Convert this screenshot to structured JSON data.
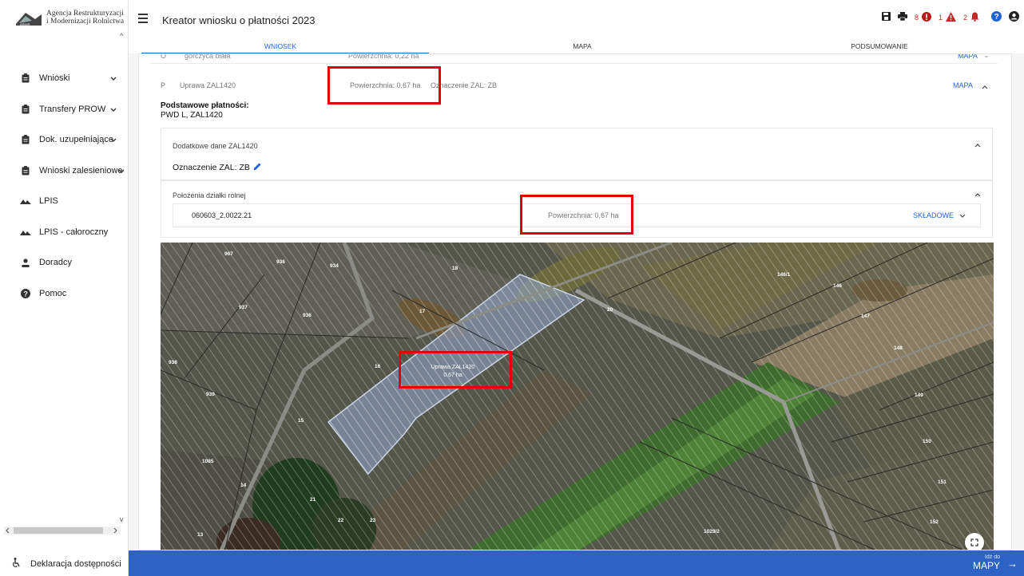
{
  "logo": {
    "line1": "Agencja Restrukturyzacji",
    "line2": "i Modernizacji Rolnictwa",
    "seal_text": "ARiMR"
  },
  "sidebar": {
    "items": [
      {
        "label": "Wnioski",
        "icon": "clipboard-icon",
        "chevron": true
      },
      {
        "label": "Transfery PROW",
        "icon": "clipboard-icon",
        "chevron": true
      },
      {
        "label": "Dok. uzupełniające",
        "icon": "clipboard-icon",
        "chevron": true
      },
      {
        "label": "Wnioski zalesieniowe",
        "icon": "clipboard-icon",
        "chevron": true
      },
      {
        "label": "LPIS",
        "icon": "mountain-icon",
        "chevron": false
      },
      {
        "label": "LPIS - całoroczny",
        "icon": "mountain-icon",
        "chevron": false
      },
      {
        "label": "Doradcy",
        "icon": "person-icon",
        "chevron": false
      },
      {
        "label": "Pomoc",
        "icon": "help-icon",
        "chevron": false
      }
    ],
    "footer_label": "Deklaracja dostępności"
  },
  "header": {
    "title": "Kreator wniosku o płatności 2023",
    "errors_count": "8",
    "warnings_count": "1",
    "notifications_count": "2"
  },
  "tabs": [
    {
      "label": "WNIOSEK",
      "active": true
    },
    {
      "label": "MAPA",
      "active": false
    },
    {
      "label": "PODSUMOWANIE",
      "active": false
    }
  ],
  "rows": {
    "o": {
      "letter": "O",
      "name": "gorczyca biała",
      "area": "Powierzchnia: 0,22 ha",
      "action": "MAPA"
    },
    "p": {
      "letter": "P",
      "name": "Uprawa ZAL1420",
      "area": "Powierzchnia: 0,67 ha",
      "designation": "Oznaczenie ZAL: ZB",
      "action": "MAPA"
    }
  },
  "basic_payments": {
    "title": "Podstawowe płatności:",
    "value": "PWD L, ZAL1420"
  },
  "extra_data": {
    "title": "Dodatkowe dane ZAL1420",
    "designation": "Oznaczenie ZAL: ZB"
  },
  "plot_location": {
    "title": "Położenia działki rolnej",
    "plot_id": "060603_2.0022.21",
    "area": "Powierzchnia: 0,67 ha",
    "action": "SKŁADOWE"
  },
  "map": {
    "parcel_label": "Uprawa ZAL1420",
    "parcel_area": "0.67 ha",
    "parcel_numbers": [
      "967",
      "936",
      "934",
      "18",
      "146/1",
      "146",
      "147",
      "937",
      "936",
      "17",
      "20",
      "148",
      "938",
      "16",
      "939",
      "149",
      "15",
      "150",
      "1085",
      "151",
      "14",
      "21",
      "22",
      "23",
      "152",
      "13",
      "1029/2"
    ]
  },
  "bottom": {
    "goto_small": "Idź do",
    "goto_big": "MAPY"
  },
  "colors": {
    "accent": "#1e63d6",
    "bottom_bar": "#2d63c6",
    "highlight": "#e00000",
    "error": "#c62828"
  }
}
